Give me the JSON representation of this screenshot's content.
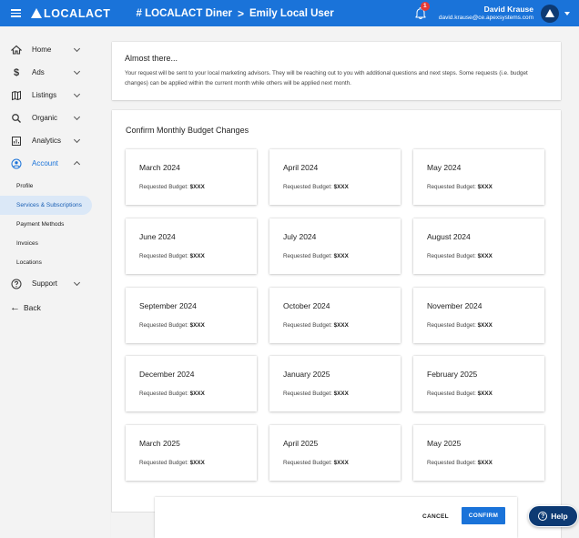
{
  "topbar": {
    "logo": "LOCALACT",
    "breadcrumb": [
      "# LOCALACT Diner",
      "Emily Local User"
    ],
    "breadcrumb_sep": ">",
    "notification_count": "1",
    "user_name": "David Krause",
    "user_email": "david.krause@ce.apexsystems.com"
  },
  "sidebar": {
    "items": [
      {
        "label": "Home",
        "icon": "home-icon"
      },
      {
        "label": "Ads",
        "icon": "dollar-icon"
      },
      {
        "label": "Listings",
        "icon": "map-icon"
      },
      {
        "label": "Organic",
        "icon": "search-icon"
      },
      {
        "label": "Analytics",
        "icon": "analytics-icon"
      },
      {
        "label": "Account",
        "icon": "account-circle-icon"
      }
    ],
    "account_sub": [
      "Profile",
      "Services & Subscriptions",
      "Payment Methods",
      "Invoices",
      "Locations"
    ],
    "support": "Support",
    "back": "Back"
  },
  "info": {
    "title": "Almost there...",
    "text": "Your request will be sent to your local marketing advisors. They will be reaching out to you with additional questions and next steps. Some requests (i.e. budget changes) can be applied within the current month while others will be applied next month."
  },
  "budget": {
    "title": "Confirm Monthly Budget Changes",
    "label": "Requested Budget:",
    "months": [
      {
        "name": "March 2024",
        "value": "$XXX"
      },
      {
        "name": "April 2024",
        "value": "$XXX"
      },
      {
        "name": "May 2024",
        "value": "$XXX"
      },
      {
        "name": "June 2024",
        "value": "$XXX"
      },
      {
        "name": "July 2024",
        "value": "$XXX"
      },
      {
        "name": "August 2024",
        "value": "$XXX"
      },
      {
        "name": "September 2024",
        "value": "$XXX"
      },
      {
        "name": "October 2024",
        "value": "$XXX"
      },
      {
        "name": "November 2024",
        "value": "$XXX"
      },
      {
        "name": "December 2024",
        "value": "$XXX"
      },
      {
        "name": "January 2025",
        "value": "$XXX"
      },
      {
        "name": "February 2025",
        "value": "$XXX"
      },
      {
        "name": "March 2025",
        "value": "$XXX"
      },
      {
        "name": "April 2025",
        "value": "$XXX"
      },
      {
        "name": "May 2025",
        "value": "$XXX"
      }
    ]
  },
  "actions": {
    "cancel": "CANCEL",
    "confirm": "CONFIRM",
    "help": "Help"
  },
  "colors": {
    "primary": "#1a73d9",
    "dark": "#0d3a73",
    "badge": "#e53935"
  }
}
